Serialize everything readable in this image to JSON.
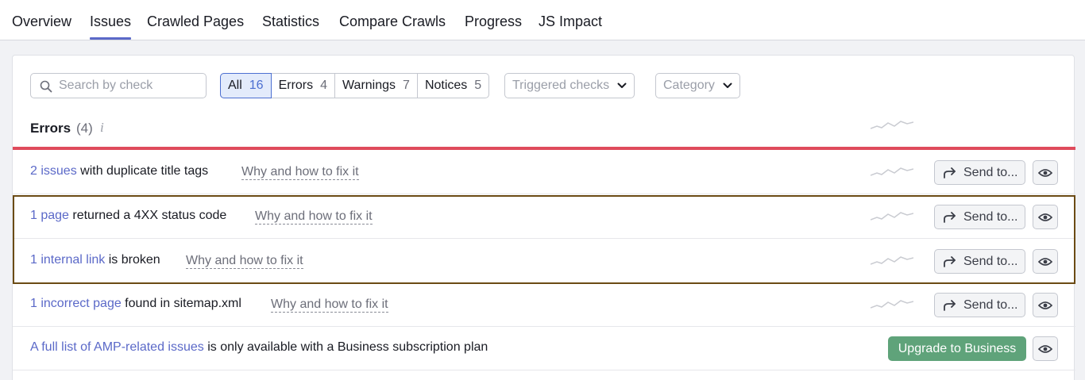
{
  "nav": {
    "tabs": [
      {
        "label": "Overview"
      },
      {
        "label": "Issues",
        "active": true
      },
      {
        "label": "Crawled Pages"
      },
      {
        "label": "Statistics"
      },
      {
        "label": "Compare Crawls"
      },
      {
        "label": "Progress"
      },
      {
        "label": "JS Impact"
      }
    ]
  },
  "filters": {
    "search_placeholder": "Search by check",
    "segments": [
      {
        "label": "All",
        "count": "16",
        "active": true
      },
      {
        "label": "Errors",
        "count": "4"
      },
      {
        "label": "Warnings",
        "count": "7"
      },
      {
        "label": "Notices",
        "count": "5"
      }
    ],
    "triggered_checks": "Triggered checks",
    "category": "Category"
  },
  "section": {
    "title": "Errors",
    "count": "(4)",
    "info_icon": "i"
  },
  "colors": {
    "link": "#5b69c8",
    "error_line": "#df4b5c",
    "upgrade_green": "#5fa37a",
    "highlight_border": "#6b4b14"
  },
  "rows": [
    {
      "link": "2 issues",
      "text": " with duplicate title tags",
      "why": "Why and how to fix it",
      "send": "Send to..."
    },
    {
      "link": "1 page",
      "text": " returned a 4XX status code",
      "why": "Why and how to fix it",
      "send": "Send to..."
    },
    {
      "link": "1 internal link",
      "text": " is broken",
      "why": "Why and how to fix it",
      "send": "Send to..."
    },
    {
      "link": "1 incorrect page",
      "text": " found in sitemap.xml",
      "why": "Why and how to fix it",
      "send": "Send to..."
    }
  ],
  "amp": {
    "link": "A full list of AMP-related issues",
    "text": " is only available with a Business subscription plan",
    "button": "Upgrade to Business"
  },
  "icons": {
    "search": "search-icon",
    "chevron": "chevron-down-icon",
    "share": "share-arrow-icon",
    "eye": "eye-icon",
    "trend": "sparkline-icon"
  }
}
